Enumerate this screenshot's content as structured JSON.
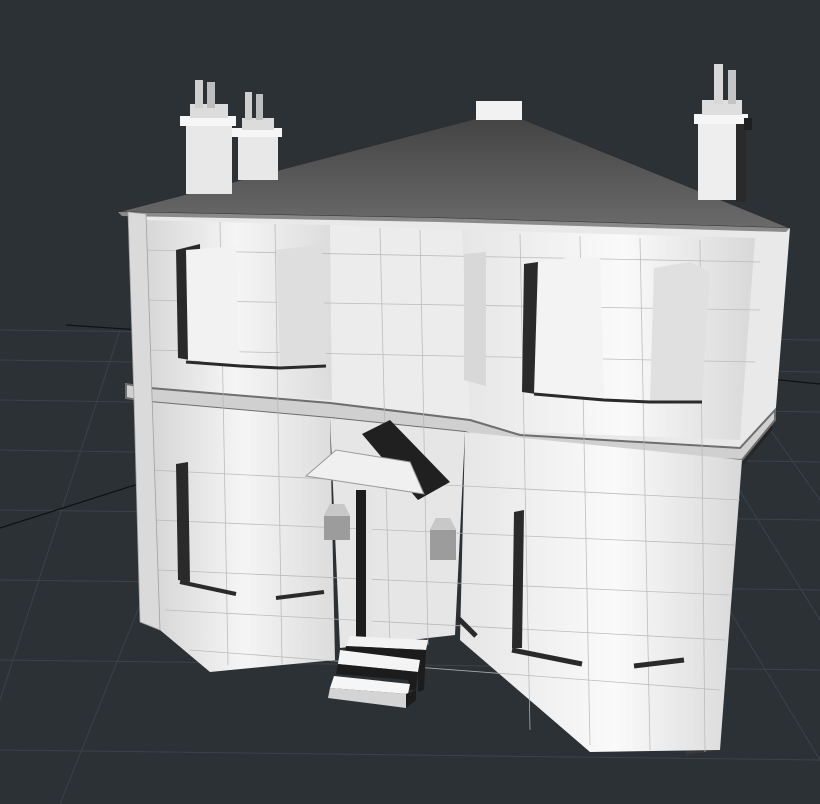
{
  "viewport": {
    "background": "#2c3136",
    "grid_color": "#3c4248",
    "axis_color": "#0f1114",
    "model": {
      "wall_color": "#eeeeee",
      "wall_shade": "#d9d9d9",
      "roof_color": "#5a5a5a",
      "opening_color": "#2b2b2b",
      "edge_color": "#9a9a9a"
    }
  }
}
